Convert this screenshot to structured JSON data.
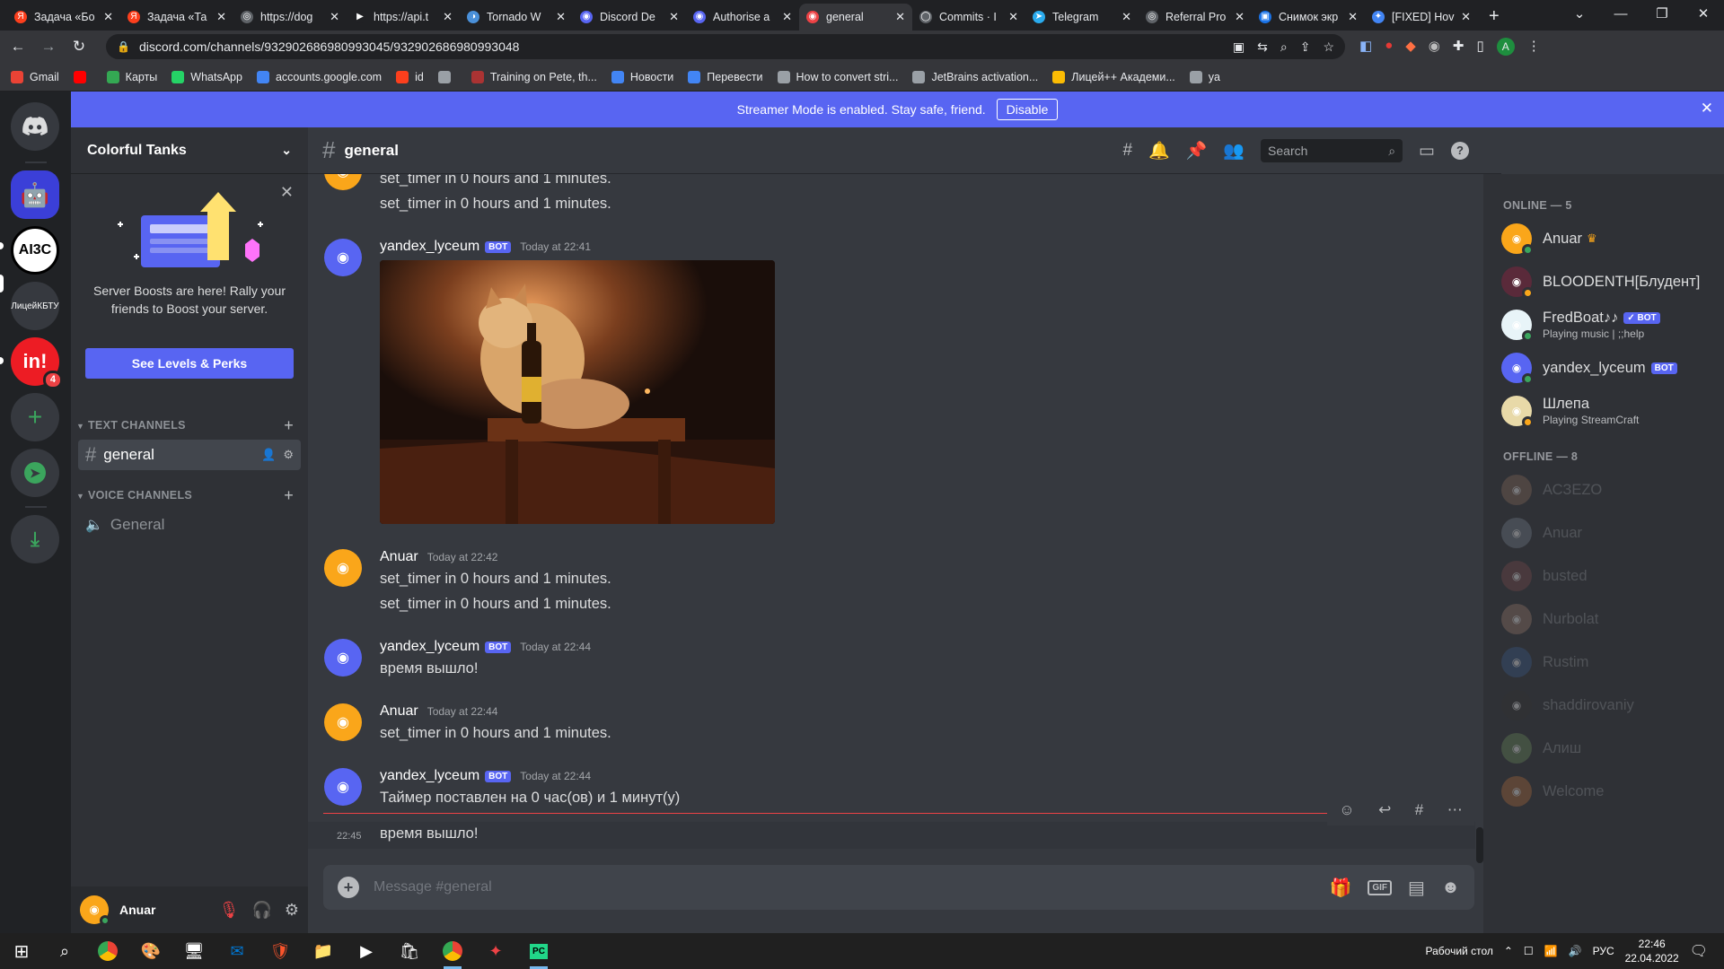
{
  "browser": {
    "tabs": [
      {
        "title": "Задача «Бо",
        "color": "#fc3f1d",
        "glyph": "Я"
      },
      {
        "title": "Задача «Та",
        "color": "#fc3f1d",
        "glyph": "Я"
      },
      {
        "title": "https://dog",
        "color": "#5f6368",
        "glyph": "◎"
      },
      {
        "title": "https://api.t",
        "color": "#202124",
        "glyph": "▶"
      },
      {
        "title": "Tornado W",
        "color": "#4a90d9",
        "glyph": "◑"
      },
      {
        "title": "Discord De",
        "color": "#5865f2",
        "glyph": "◉"
      },
      {
        "title": "Authorise a",
        "color": "#5865f2",
        "glyph": "◉"
      },
      {
        "title": "general",
        "color": "#ed4245",
        "glyph": "◉"
      },
      {
        "title": "Commits · I",
        "color": "#5f6368",
        "glyph": "◯"
      },
      {
        "title": "Telegram",
        "color": "#2aabee",
        "glyph": "➤"
      },
      {
        "title": "Referral Pro",
        "color": "#5f6368",
        "glyph": "◎"
      },
      {
        "title": "Снимок экр",
        "color": "#1a73e8",
        "glyph": "▣"
      },
      {
        "title": "[FIXED] Hov",
        "color": "#4285f4",
        "glyph": "✦"
      }
    ],
    "url": "discord.com/channels/932902686980993045/932902686980993048",
    "bookmarks": [
      {
        "label": "Gmail",
        "color": "#ea4335"
      },
      {
        "label": "",
        "color": "#ff0000"
      },
      {
        "label": "Карты",
        "color": "#34a853"
      },
      {
        "label": "WhatsApp",
        "color": "#25d366"
      },
      {
        "label": "accounts.google.com",
        "color": "#4285f4"
      },
      {
        "label": "id",
        "color": "#fc3f1d"
      },
      {
        "label": "",
        "color": "#9aa0a6"
      },
      {
        "label": "Training on Pete, th...",
        "color": "#a33"
      },
      {
        "label": "Новости",
        "color": "#4285f4"
      },
      {
        "label": "Перевести",
        "color": "#4285f4"
      },
      {
        "label": "How to convert stri...",
        "color": "#9aa0a6"
      },
      {
        "label": "JetBrains activation...",
        "color": "#9aa0a6"
      },
      {
        "label": "Лицей++ Академи...",
        "color": "#fbbc04"
      },
      {
        "label": "ya",
        "color": "#9aa0a6"
      }
    ]
  },
  "banner": {
    "text": "Streamer Mode is enabled. Stay safe, friend.",
    "button": "Disable"
  },
  "guilds": [
    {
      "label": "",
      "color": "#5865f2",
      "icon": "discord-home"
    },
    {
      "label": "",
      "color": "#3b3fd8",
      "icon": "robot"
    },
    {
      "label": "AI3C",
      "color": "#ffffff",
      "icon": "aijc"
    },
    {
      "label": "ЛицейКБТУ",
      "color": "#36393f",
      "icon": "text"
    },
    {
      "label": "in!",
      "color": "#ed1c24",
      "icon": "in",
      "badge": "4"
    },
    {
      "label": "+",
      "color": "#36393f",
      "icon": "add"
    },
    {
      "label": "",
      "color": "#36393f",
      "icon": "explore"
    },
    {
      "label": "",
      "color": "#36393f",
      "icon": "download"
    }
  ],
  "server": {
    "name": "Colorful Tanks"
  },
  "boost": {
    "text": "Server Boosts are here! Rally your friends to Boost your server.",
    "button": "See Levels & Perks"
  },
  "categories": {
    "text": "TEXT CHANNELS",
    "voice": "VOICE CHANNELS"
  },
  "channels": {
    "text": [
      {
        "name": "general"
      }
    ],
    "voice": [
      {
        "name": "General"
      }
    ]
  },
  "user": {
    "name": "Anuar"
  },
  "chat": {
    "channel": "general",
    "search_placeholder": "Search",
    "composer_placeholder": "Message #general"
  },
  "messages": {
    "m0_l1": "set_timer in 0 hours and 1 minutes.",
    "m0_l2": "set_timer in 0 hours and 1 minutes.",
    "m1": {
      "author": "yandex_lyceum",
      "badge": "BOT",
      "time": "Today at 22:41"
    },
    "m2": {
      "author": "Anuar",
      "time": "Today at 22:42",
      "l1": "set_timer in 0 hours and 1 minutes.",
      "l2": "set_timer in 0 hours and 1 minutes."
    },
    "m3": {
      "author": "yandex_lyceum",
      "badge": "BOT",
      "time": "Today at 22:44",
      "l1": "время вышло!"
    },
    "m4": {
      "author": "Anuar",
      "time": "Today at 22:44",
      "l1": "set_timer in 0 hours and 1 minutes."
    },
    "m5": {
      "author": "yandex_lyceum",
      "badge": "BOT",
      "time": "Today at 22:44",
      "l1": "Таймер поставлен на 0 час(ов) и 1 минут(у)"
    },
    "m6": {
      "time": "22:45",
      "l1": "время вышло!"
    }
  },
  "members": {
    "online_header": "ONLINE — 5",
    "offline_header": "OFFLINE — 8",
    "online": [
      {
        "name": "Anuar",
        "color": "#faa61a",
        "status": "#3ba55d",
        "crown": "♛",
        "activity": "",
        "bot": ""
      },
      {
        "name": "BLOODENTH[Блудент]",
        "color": "#5a2a3a",
        "status": "#faa61a",
        "crown": "",
        "activity": "",
        "bot": ""
      },
      {
        "name": "FredBoat♪♪",
        "color": "#e8f4f8",
        "status": "#3ba55d",
        "crown": "",
        "activity": "Playing music | ;;help",
        "bot": "✓ BOT"
      },
      {
        "name": "yandex_lyceum",
        "color": "#5865f2",
        "status": "#3ba55d",
        "crown": "",
        "activity": "",
        "bot": "BOT"
      },
      {
        "name": "Шлепа",
        "color": "#e8d9a8",
        "status": "#faa61a",
        "crown": "",
        "activity": "Playing StreamCraft",
        "bot": ""
      }
    ],
    "offline": [
      {
        "name": "АСЗЕZO",
        "color": "#8a6a5a"
      },
      {
        "name": "Anuar",
        "color": "#747f8d"
      },
      {
        "name": "busted",
        "color": "#7a4a4a"
      },
      {
        "name": "Nurbolat",
        "color": "#9a7a6a"
      },
      {
        "name": "Rustim",
        "color": "#3a5a8a"
      },
      {
        "name": "shaddirovaniy",
        "color": "#333333"
      },
      {
        "name": "Алиш",
        "color": "#6a8a5a"
      },
      {
        "name": "Welcome",
        "color": "#b06a3a"
      }
    ]
  },
  "taskbar": {
    "desktop_label": "Рабочий стол",
    "lang": "РУС",
    "time": "22:46",
    "date": "22.04.2022",
    "notif": "1"
  }
}
